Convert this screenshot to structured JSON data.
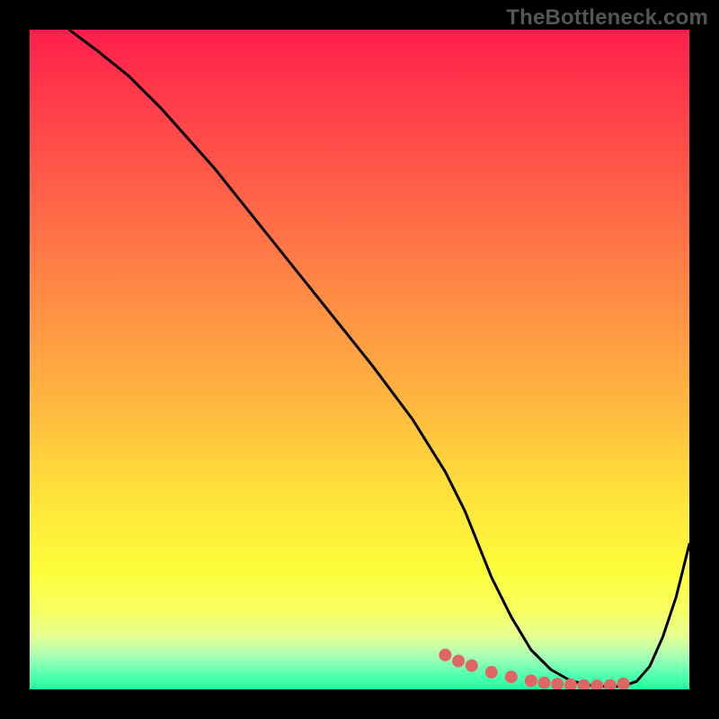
{
  "watermark": "TheBottleneck.com",
  "chart_data": {
    "type": "line",
    "title": "",
    "xlabel": "",
    "ylabel": "",
    "xlim": [
      0,
      100
    ],
    "ylim": [
      0,
      100
    ],
    "grid": false,
    "legend": false,
    "series": [
      {
        "name": "bottleneck-curve",
        "stroke": "#000000",
        "x": [
          6,
          10,
          15,
          20,
          28,
          36,
          44,
          52,
          58,
          63,
          66,
          68,
          70,
          73,
          76,
          79,
          82,
          85,
          88,
          90,
          92,
          94,
          96,
          98,
          100
        ],
        "values": [
          100,
          97,
          93,
          88,
          79,
          69,
          59,
          49,
          41,
          33,
          27,
          22,
          17,
          11,
          6,
          3,
          1.3,
          0.6,
          0.4,
          0.5,
          1.2,
          3.5,
          8,
          14,
          22
        ]
      }
    ],
    "markers": {
      "name": "sweet-spot-markers",
      "color": "#e06666",
      "x": [
        63,
        65,
        67,
        70,
        73,
        76,
        78,
        80,
        82,
        84,
        86,
        88,
        90
      ],
      "values": [
        5.2,
        4.3,
        3.6,
        2.6,
        1.9,
        1.3,
        1.0,
        0.8,
        0.7,
        0.6,
        0.55,
        0.6,
        0.85
      ]
    },
    "background_gradient": {
      "direction": "vertical",
      "stops": [
        {
          "pos": 0.0,
          "color": "#ff1e4c"
        },
        {
          "pos": 0.5,
          "color": "#ffbb3f"
        },
        {
          "pos": 0.82,
          "color": "#fdfd3a"
        },
        {
          "pos": 1.0,
          "color": "#1dff9d"
        }
      ]
    }
  }
}
